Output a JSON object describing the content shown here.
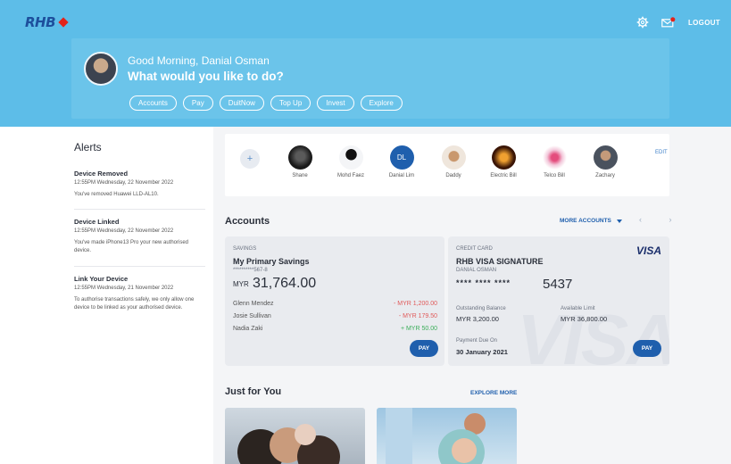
{
  "brand": {
    "logo_text": "RHB"
  },
  "header": {
    "logout_label": "LOGOUT",
    "greeting": "Good Morning, Danial Osman",
    "prompt": "What would you like to do?",
    "quick_actions": [
      "Accounts",
      "Pay",
      "DuitNow",
      "Top Up",
      "Invest",
      "Explore"
    ]
  },
  "alerts": {
    "title": "Alerts",
    "items": [
      {
        "title": "Device Removed",
        "time": "12:55PM Wednesday, 22 November 2022",
        "body": "You've removed Huawei LLD-AL10."
      },
      {
        "title": "Device Linked",
        "time": "12:55PM Wednesday, 22 November 2022",
        "body": "You've made iPhone13 Pro your new authorised device."
      },
      {
        "title": "Link Your Device",
        "time": "12:55PM Wednesday, 21 November 2022",
        "body": "To authorise transactions safely, we only allow one device to be linked as your authorised device."
      }
    ]
  },
  "favourites": {
    "edit_label": "EDIT",
    "items": [
      {
        "name": "Shane",
        "initials": "",
        "color": "#2b2b2b"
      },
      {
        "name": "Mohd Faez",
        "initials": "",
        "color": "#1d1d1d"
      },
      {
        "name": "Danial Lim",
        "initials": "DL",
        "color": "#1f5fad"
      },
      {
        "name": "Daddy",
        "initials": "",
        "color": "#d9c2a8"
      },
      {
        "name": "Electric Bill",
        "initials": "",
        "color": "#6a2e12"
      },
      {
        "name": "Telco Bill",
        "initials": "",
        "color": "#e6a8c4"
      },
      {
        "name": "Zachary",
        "initials": "",
        "color": "#5b6470"
      }
    ]
  },
  "accounts": {
    "title": "Accounts",
    "more_label": "MORE ACCOUNTS",
    "nav_arrows": "‹ ›",
    "savings": {
      "type": "SAVINGS",
      "name": "My Primary Savings",
      "number": "**********567-8",
      "currency": "MYR",
      "balance": "31,764.00",
      "transactions": [
        {
          "name": "Glenn Mendez",
          "amount": "- MYR 1,200.00",
          "color": "#e05a5a"
        },
        {
          "name": "Josie Sullivan",
          "amount": "- MYR 179.50",
          "color": "#e05a5a"
        },
        {
          "name": "Nadia Zaki",
          "amount": "+ MYR 50.00",
          "color": "#3cae5a"
        }
      ],
      "pay_label": "PAY"
    },
    "credit": {
      "type": "CREDIT CARD",
      "name": "RHB VISA SIGNATURE",
      "holder": "DANIAL OSMAN",
      "masked": "****  ****  ****",
      "last4": "5437",
      "brand": "VISA",
      "outstanding_label": "Outstanding Balance",
      "outstanding_value": "MYR 3,200.00",
      "limit_label": "Available Limit",
      "limit_value": "MYR 36,800.00",
      "due_label": "Payment Due On",
      "due_value": "30 January 2021",
      "pay_label": "PAY"
    }
  },
  "just_for_you": {
    "title": "Just for You",
    "explore_label": "EXPLORE MORE"
  }
}
